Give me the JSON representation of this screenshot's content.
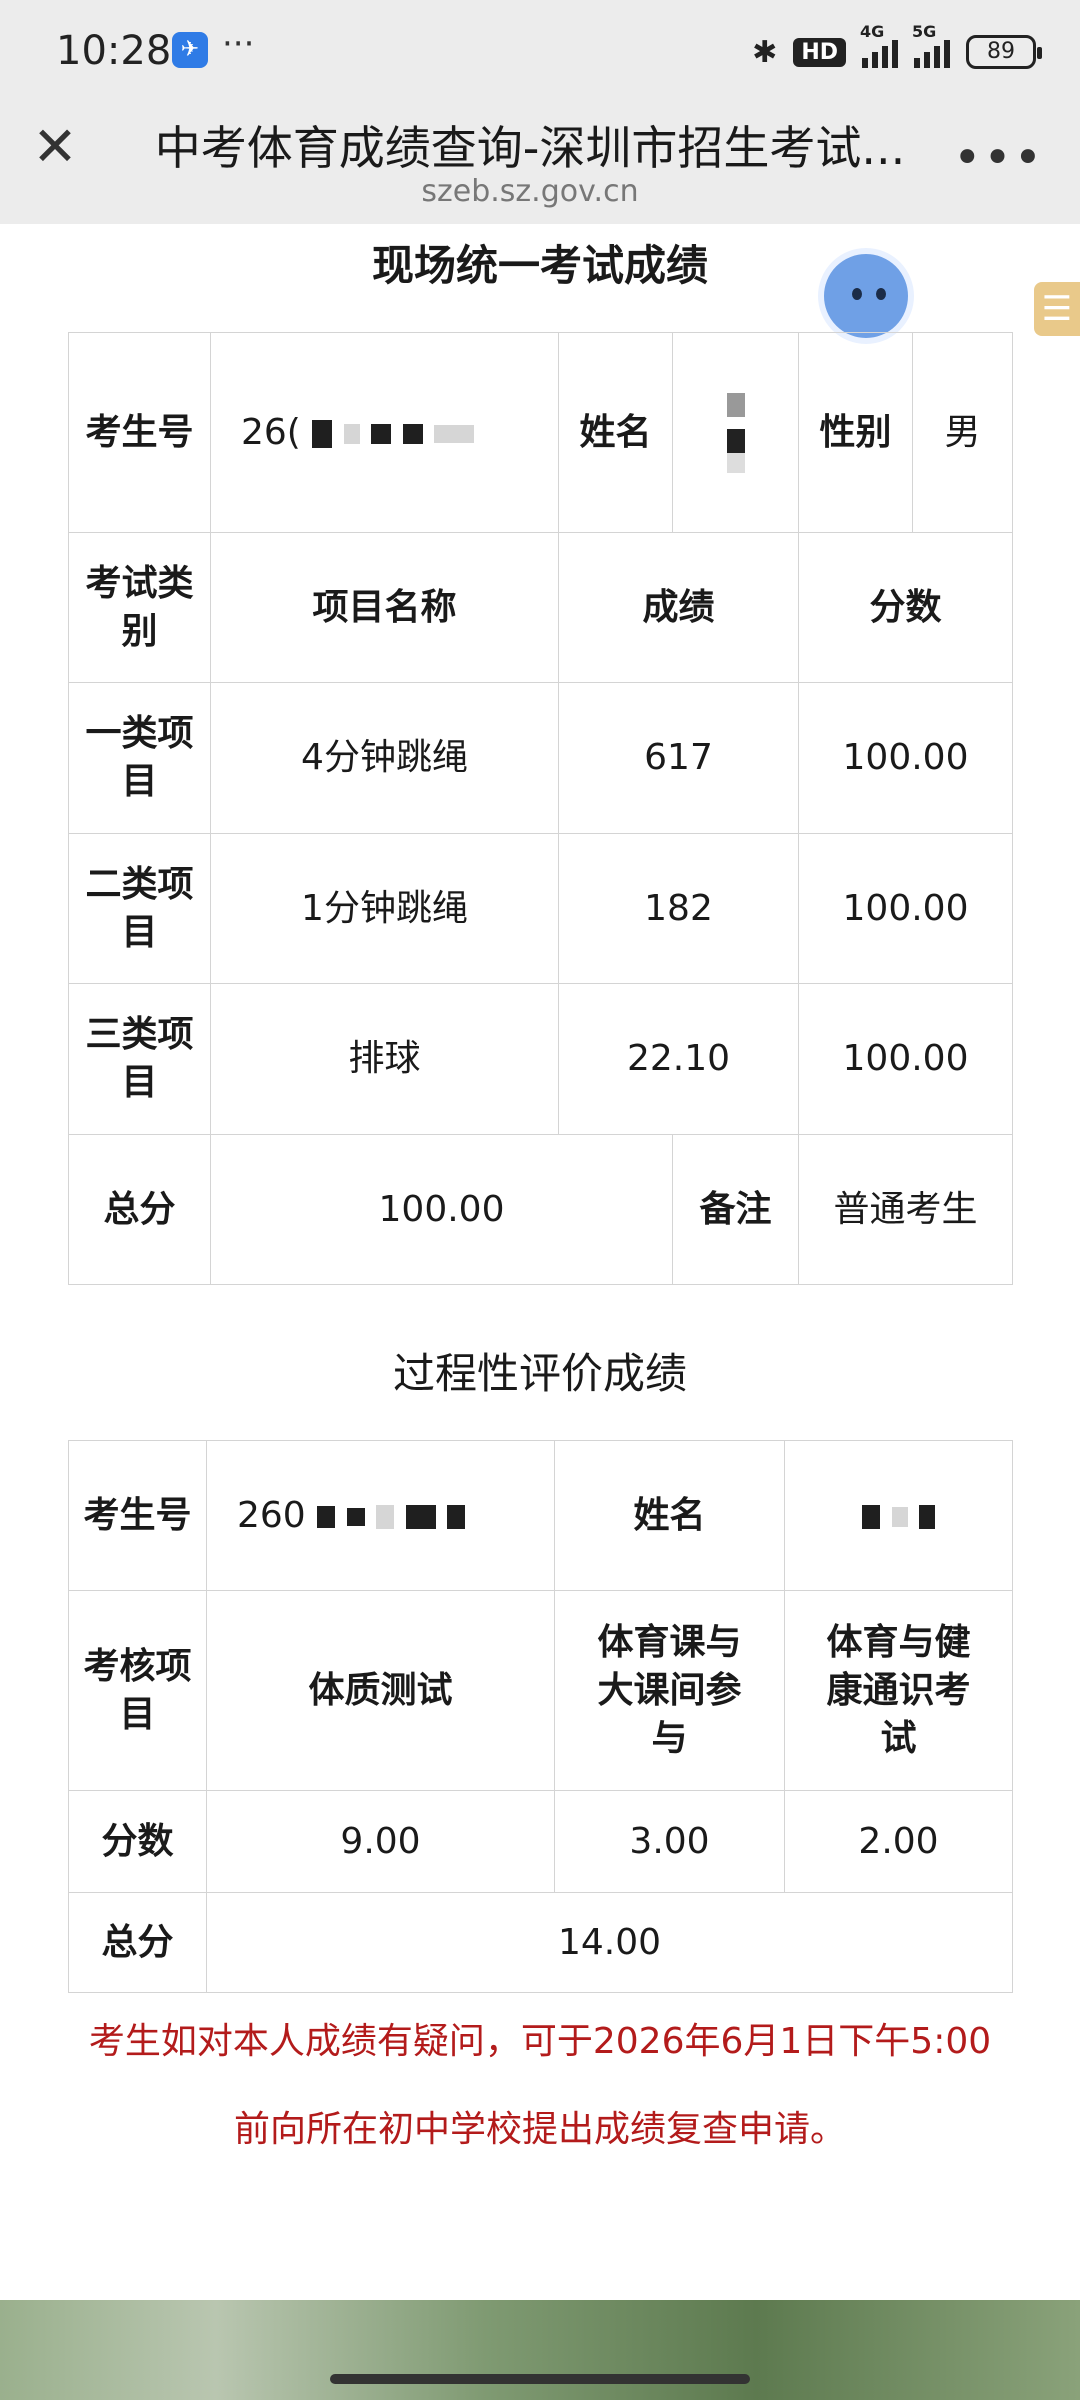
{
  "status_bar": {
    "time": "10:28",
    "more_dots": "···",
    "network_labels": [
      "4G",
      "5G"
    ],
    "hd_label": "HD",
    "battery": "89"
  },
  "browser": {
    "title": "中考体育成绩查询-深圳市招生考试...",
    "url": "szeb.sz.gov.cn",
    "close_icon": "close-icon",
    "more_icon": "more-dots-icon"
  },
  "onsite": {
    "title": "现场统一考试成绩",
    "labels": {
      "exam_no": "考生号",
      "name": "姓名",
      "gender": "性别",
      "category": "考试类别",
      "item_name": "项目名称",
      "result": "成绩",
      "score": "分数",
      "total": "总分",
      "remark": "备注"
    },
    "exam_no_value": "26(",
    "gender_value": "男",
    "rows": [
      {
        "category": "一类项目",
        "item": "4分钟跳绳",
        "result": "617",
        "score": "100.00"
      },
      {
        "category": "二类项目",
        "item": "1分钟跳绳",
        "result": "182",
        "score": "100.00"
      },
      {
        "category": "三类项目",
        "item": "排球",
        "result": "22.10",
        "score": "100.00"
      }
    ],
    "total_value": "100.00",
    "remark_value": "普通考生"
  },
  "process": {
    "title": "过程性评价成绩",
    "labels": {
      "exam_no": "考生号",
      "name": "姓名",
      "assess_item": "考核项目",
      "score": "分数",
      "total": "总分"
    },
    "exam_no_value": "260",
    "items": [
      "体质测试",
      "体育课与大课间参与",
      "体育与健康通识考试"
    ],
    "scores": [
      "9.00",
      "3.00",
      "2.00"
    ],
    "total_value": "14.00"
  },
  "notice": {
    "line1": "考生如对本人成绩有疑问，可于2026年6月1日下午5:00",
    "line2": "前向所在初中学校提出成绩复查申请。"
  },
  "colors": {
    "accent_red": "#b31b1b",
    "border": "#d4d4d4",
    "chrome": "#ececec"
  }
}
